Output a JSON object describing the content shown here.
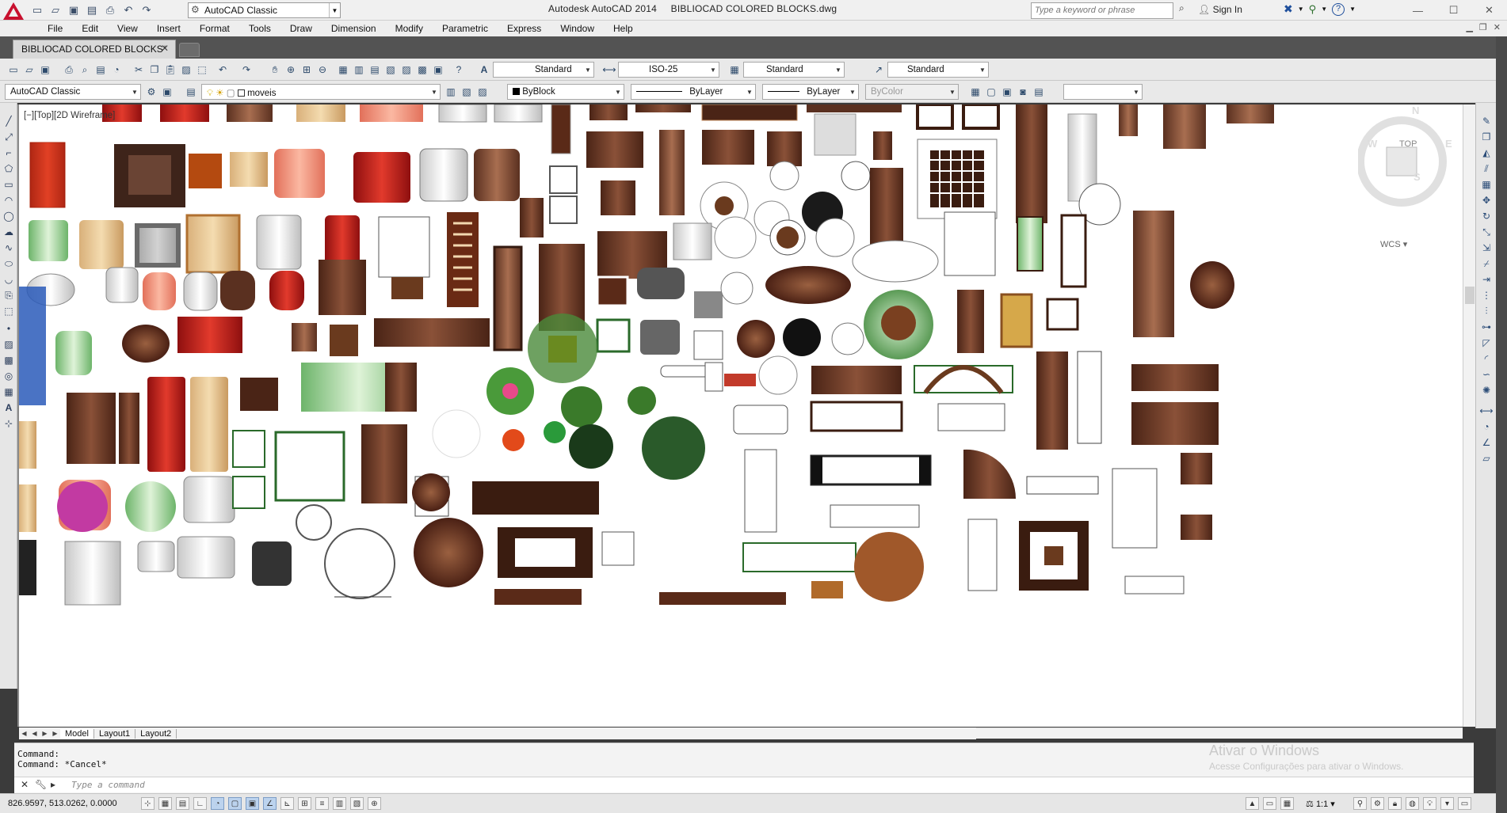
{
  "titlebar": {
    "app_name": "Autodesk AutoCAD 2014",
    "file_name": "BIBLIOCAD COLORED BLOCKS.dwg",
    "workspace": "AutoCAD Classic",
    "search_placeholder": "Type a keyword or phrase",
    "sign_in": "Sign In",
    "help": "?"
  },
  "menu": [
    "File",
    "Edit",
    "View",
    "Insert",
    "Format",
    "Tools",
    "Draw",
    "Dimension",
    "Modify",
    "Parametric",
    "Express",
    "Window",
    "Help"
  ],
  "file_tab": {
    "label": "BIBLIOCAD COLORED BLOCKS*",
    "close": "✕"
  },
  "toolbar1": {
    "text_style": "Standard",
    "dim_style": "ISO-25",
    "table_style": "Standard",
    "mleader_style": "Standard"
  },
  "toolbar2": {
    "workspace": "AutoCAD Classic",
    "layer": "moveis",
    "color": "ByBlock",
    "linetype": "ByLayer",
    "lineweight": "ByLayer",
    "plotstyle": "ByColor"
  },
  "viewport": {
    "label": "[−][Top][2D Wireframe]",
    "viewcube": {
      "top": "TOP",
      "n": "N",
      "s": "S",
      "e": "E",
      "w": "W"
    },
    "wcs": "WCS ▾"
  },
  "layout_tabs": [
    "Model",
    "Layout1",
    "Layout2"
  ],
  "command": {
    "history": [
      "Command:",
      "Command: *Cancel*"
    ],
    "placeholder": "Type a command"
  },
  "activation": {
    "title": "Ativar o Windows",
    "subtitle": "Acesse Configurações para ativar o Windows."
  },
  "status": {
    "coordinates": "826.9597, 513.0262, 0.0000",
    "scale": "1:1"
  },
  "colors": {
    "accent": "#c8102e",
    "wood": "#6b3a24",
    "status_active": "#bcd3ee"
  }
}
